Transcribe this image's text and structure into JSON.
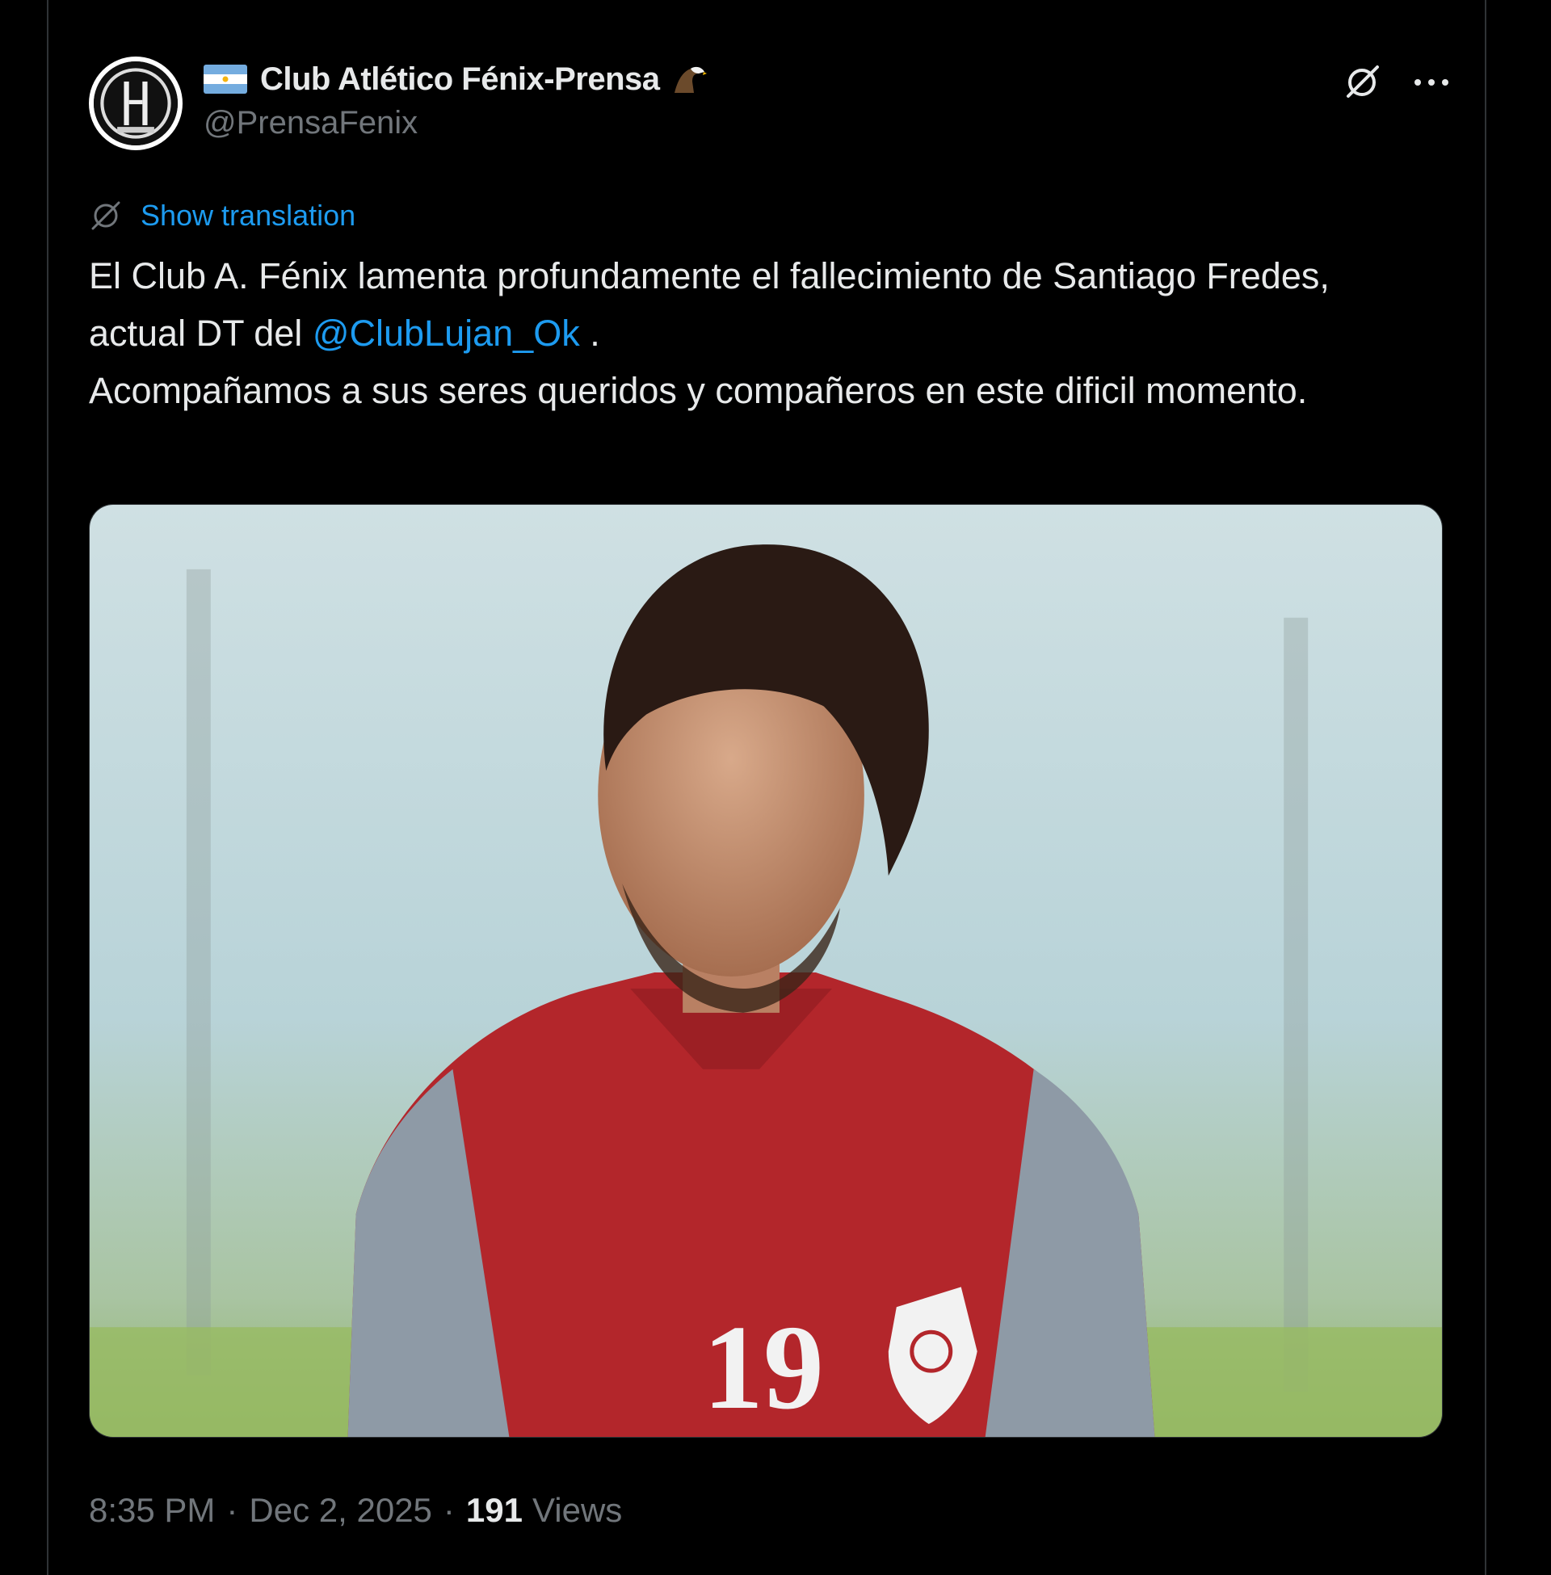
{
  "author": {
    "display_name": "Club Atlético Fénix-Prensa",
    "handle": "@PrensaFenix",
    "flag_icon": "argentina-flag-icon",
    "emoji_icon": "eagle-icon"
  },
  "actions": {
    "grok_icon": "grok-icon",
    "more_icon": "more-icon"
  },
  "translation": {
    "icon": "translate-icon",
    "label": "Show translation"
  },
  "body": {
    "line1": "El Club A. Fénix lamenta profundamente el fallecimiento de Santiago Fredes, actual DT del",
    "mention": "@ClubLujan_Ok",
    "line1_end": " .",
    "line2": "Acompañamos a sus seres queridos y compañeros en este dificil momento."
  },
  "media": {
    "jersey_number": "19"
  },
  "meta": {
    "time": "8:35 PM",
    "date": "Dec 2, 2025",
    "separator": "·",
    "views_count": "191",
    "views_label": "Views"
  },
  "colors": {
    "background": "#000000",
    "text": "#e7e9ea",
    "muted": "#71767b",
    "accent": "#1d9bf0",
    "jersey_red": "#b3262b"
  }
}
